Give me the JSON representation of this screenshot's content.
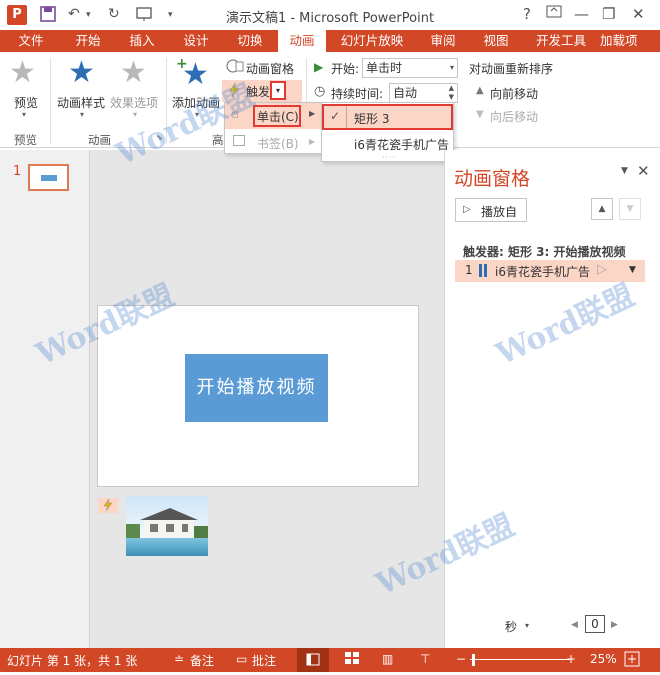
{
  "window": {
    "title": "演示文稿1 - Microsoft PowerPoint",
    "app_icon_letter": "P",
    "help": "?",
    "minimize": "—",
    "restore": "❐",
    "close": "✕"
  },
  "tabs": [
    "文件",
    "开始",
    "插入",
    "设计",
    "切换",
    "动画",
    "幻灯片放映",
    "审阅",
    "视图",
    "开发工具",
    "加载项"
  ],
  "ribbon": {
    "preview_label": "预览",
    "group_preview": "预览",
    "anim_style_label": "动画样式",
    "effect_options_label": "效果选项",
    "group_animation": "动画",
    "add_anim_label": "添加动画",
    "group_advanced": "高",
    "anim_pane_label": "动画窗格",
    "trigger_label": "触发",
    "start_label": "开始:",
    "start_value": "单击时",
    "duration_label": "持续时间:",
    "duration_value": "自动",
    "reorder_label": "对动画重新排序",
    "move_forward": "向前移动",
    "move_backward": "向后移动"
  },
  "trigger_menu": {
    "on_click": "单击(C)",
    "bookmark": "书签(B)"
  },
  "submenu": {
    "items": [
      "矩形 3",
      "i6青花瓷手机广告"
    ],
    "checked_index": 0
  },
  "thumb_pane": {
    "slide_number": "1"
  },
  "slide": {
    "button_text": "开始播放视频"
  },
  "anim_pane": {
    "title": "动画窗格",
    "play_button": "播放自",
    "trigger_header": "触发器: 矩形 3: 开始播放视频",
    "item_number": "1",
    "item_label": "i6青花瓷手机广告",
    "timeline_unit": "秒",
    "timeline_value": "0"
  },
  "status": {
    "slide_info": "幻灯片 第 1 张，共 1 张",
    "notes": "备注",
    "comments": "批注",
    "zoom": "25%"
  },
  "watermark": "Word联盟",
  "colors": {
    "accent": "#d24726",
    "shape_fill": "#5b9bd5",
    "highlight": "#fbd5c5",
    "star_blue": "#2f6eb5"
  }
}
